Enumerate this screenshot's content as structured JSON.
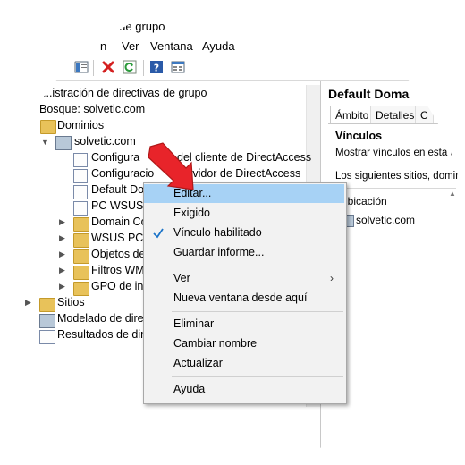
{
  "window": {
    "title": "...tivas de grupo"
  },
  "menubar": {
    "items": [
      "n",
      "Ver",
      "Ventana",
      "Ayuda"
    ]
  },
  "tree": {
    "root_label": "...istración de directivas de grupo",
    "forest_label": "Bosque: solvetic.com",
    "domains_label": "Dominios",
    "domain_label": "solvetic.com",
    "items": [
      "Configura... del cliente de DirectAccess",
      "Configuració... servidor de DirectAccess",
      "Default Do...",
      "PC WSUS",
      "Domain Co...",
      "WSUS PC",
      "Objetos de...",
      "Filtros WM...",
      "GPO de ini..."
    ],
    "item_texts": [
      "Configura",
      "del cliente de DirectAccess",
      "Configuracio",
      "servidor de DirectAccess",
      "Default Do",
      "PC WSUS",
      "Domain Co",
      "WSUS PC",
      "Objetos de",
      "Filtros WM",
      "GPO de ini"
    ],
    "sites_label": "Sitios",
    "modeling_label": "Modelado de direc",
    "results_label": "Resultados de dire"
  },
  "right_pane": {
    "title": "Default Doma",
    "tabs": [
      "Ámbito",
      "Detalles",
      "C"
    ],
    "section_title": "Vínculos",
    "show_links_text": "Mostrar vínculos en esta u",
    "sites_text": "Los siguientes sitios, domin",
    "column_header": "Ubicación",
    "location_value": "solvetic.com"
  },
  "context_menu": {
    "items": [
      {
        "label": "Editar...",
        "highlighted": true
      },
      {
        "label": "Exigido"
      },
      {
        "label": "Vínculo habilitado",
        "checked": true
      },
      {
        "label": "Guardar informe..."
      },
      {
        "label": "Ver",
        "submenu": true
      },
      {
        "label": "Nueva ventana desde aquí"
      },
      {
        "label": "Eliminar"
      },
      {
        "label": "Cambiar nombre"
      },
      {
        "label": "Actualizar"
      },
      {
        "label": "Ayuda"
      }
    ]
  },
  "colors": {
    "highlight": "#a7d2f5",
    "arrow": "#e8242a",
    "check": "#1a73c8"
  }
}
